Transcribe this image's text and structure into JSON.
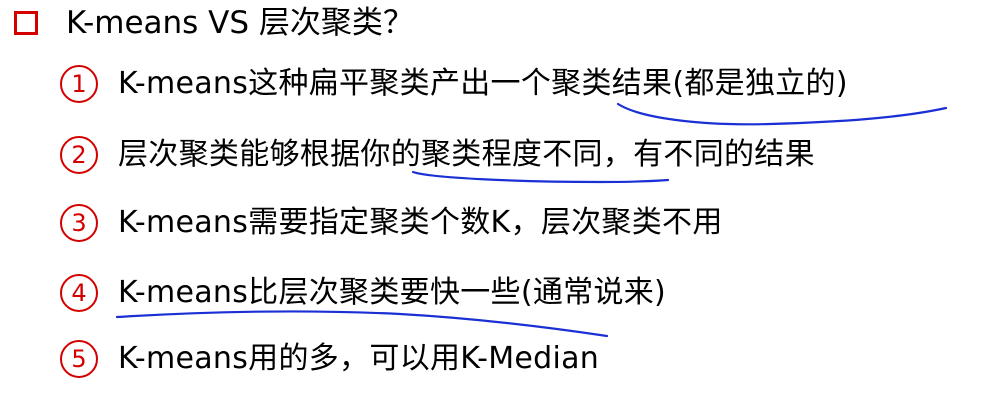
{
  "heading": {
    "marker_icon": "hollow-square",
    "text": "K-means VS 层次聚类？"
  },
  "items": [
    {
      "number": "1",
      "text": "K-means这种扁平聚类产出一个聚类结果(都是独立的)"
    },
    {
      "number": "2",
      "text": "层次聚类能够根据你的聚类程度不同，有不同的结果"
    },
    {
      "number": "3",
      "text": "K-means需要指定聚类个数K，层次聚类不用"
    },
    {
      "number": "4",
      "text": "K-means比层次聚类要快一些(通常说来)"
    },
    {
      "number": "5",
      "text": "K-means用的多，可以用K-Median"
    }
  ],
  "colors": {
    "accent": "#d40000",
    "annotation": "#1a2fd4",
    "text": "#000000"
  }
}
